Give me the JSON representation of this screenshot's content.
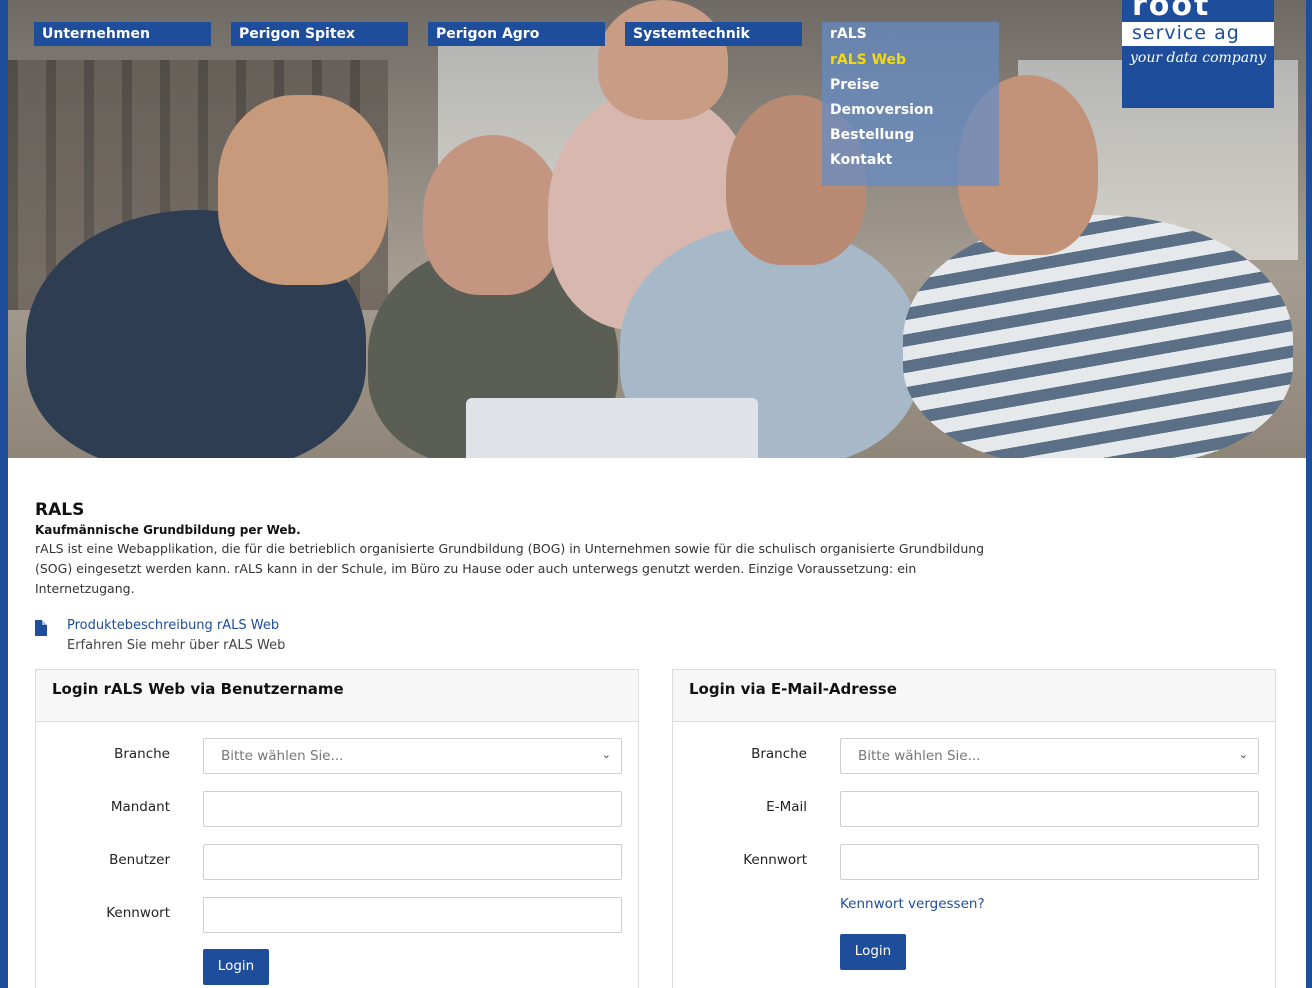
{
  "nav": {
    "items": [
      {
        "label": "Unternehmen"
      },
      {
        "label": "Perigon Spitex"
      },
      {
        "label": "Perigon Agro"
      },
      {
        "label": "Systemtechnik"
      }
    ],
    "dropdown": {
      "label": "rALS",
      "items": [
        {
          "label": "rALS Web",
          "active": true
        },
        {
          "label": "Preise",
          "active": false
        },
        {
          "label": "Demoversion",
          "active": false
        },
        {
          "label": "Bestellung",
          "active": false
        },
        {
          "label": "Kontakt",
          "active": false
        }
      ]
    }
  },
  "logo": {
    "brand_top": "root",
    "name": "service ag",
    "tagline": "your data company"
  },
  "intro": {
    "title": "RALS",
    "subtitle": "Kaufmännische Grundbildung per Web.",
    "description": "rALS ist eine Webapplikation, die für die betrieblich organisierte Grundbildung (BOG) in Unternehmen sowie für die schulisch organisierte Grundbildung (SOG) eingesetzt werden kann. rALS kann in der Schule, im Büro zu Hause oder auch unterwegs genutzt werden. Einzige Voraussetzung: ein Internetzugang."
  },
  "document": {
    "title": "Produktebeschreibung rALS Web",
    "subtitle": "Erfahren Sie mehr über rALS Web"
  },
  "login_username": {
    "heading": "Login rALS Web via Benutzername",
    "branche_label": "Branche",
    "branche_placeholder": "Bitte wählen Sie...",
    "mandant_label": "Mandant",
    "benutzer_label": "Benutzer",
    "kennwort_label": "Kennwort",
    "login_button": "Login"
  },
  "login_email": {
    "heading": "Login via E-Mail-Adresse",
    "branche_label": "Branche",
    "branche_placeholder": "Bitte wählen Sie...",
    "email_label": "E-Mail",
    "kennwort_label": "Kennwort",
    "forgot_link": "Kennwort vergessen?",
    "login_button": "Login"
  },
  "colors": {
    "brand_blue": "#1e4d9b",
    "active_nav_yellow": "#f5d90a",
    "dropdown_bg": "#648cc8"
  }
}
